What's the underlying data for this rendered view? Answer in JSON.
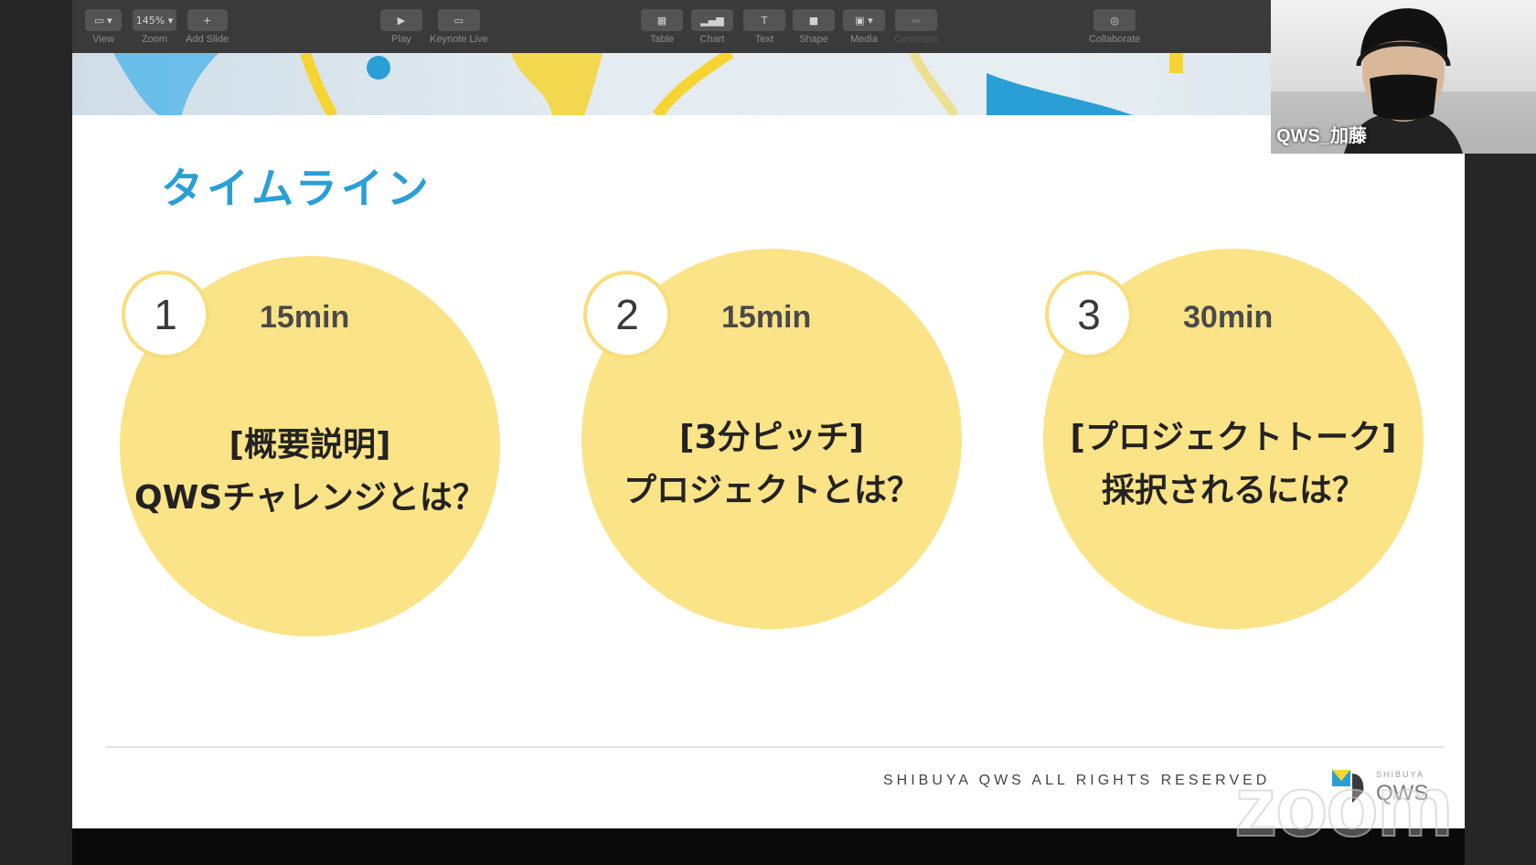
{
  "toolbar": {
    "view": {
      "label": "View"
    },
    "zoom": {
      "label": "Zoom",
      "value": "145%"
    },
    "add_slide": {
      "label": "Add Slide"
    },
    "play": {
      "label": "Play"
    },
    "keynote_live": {
      "label": "Keynote Live"
    },
    "table": {
      "label": "Table"
    },
    "chart": {
      "label": "Chart"
    },
    "text": {
      "label": "Text"
    },
    "shape": {
      "label": "Shape"
    },
    "media": {
      "label": "Media"
    },
    "comment": {
      "label": "Comment"
    },
    "collaborate": {
      "label": "Collaborate"
    }
  },
  "slide": {
    "title": "タイムライン",
    "items": [
      {
        "number": "1",
        "duration": "15min",
        "line1": "[概要説明]",
        "line2": "QWSチャレンジとは？"
      },
      {
        "number": "2",
        "duration": "15min",
        "line1": "[3分ピッチ]",
        "line2": "プロジェクトとは？"
      },
      {
        "number": "3",
        "duration": "30min",
        "line1": "[プロジェクトトーク]",
        "line2": "採択されるには？"
      }
    ],
    "copyright": "SHIBUYA QWS  ALL RIGHTS RESERVED",
    "logo": {
      "small": "SHIBUYA",
      "text": "QWS"
    }
  },
  "video": {
    "participant_name": "QWS_加藤"
  },
  "watermark": "zoom",
  "colors": {
    "title": "#2a9fd6",
    "circle": "#fbe387",
    "accent_yellow": "#f8dd7a",
    "accent_blue": "#2a9fd6"
  }
}
